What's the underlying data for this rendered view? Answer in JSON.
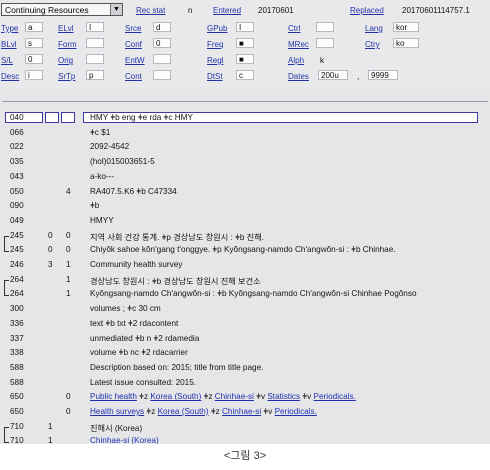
{
  "fixed_fields": {
    "material_type": "Continuing Resources",
    "rec_stat": {
      "label": "Rec stat",
      "value": "n"
    },
    "entered": {
      "label": "Entered",
      "value": "20170601"
    },
    "replaced": {
      "label": "Replaced",
      "value": "20170601114757.1"
    },
    "type": {
      "label": "Type",
      "value": "a"
    },
    "elvl": {
      "label": "ELvl",
      "value": "I"
    },
    "srce": {
      "label": "Srce",
      "value": "d"
    },
    "gpub": {
      "label": "GPub",
      "value": "I"
    },
    "ctrl": {
      "label": "Ctrl",
      "value": ""
    },
    "lang": {
      "label": "Lang",
      "value": "kor"
    },
    "blvl": {
      "label": "BLvl",
      "value": "s"
    },
    "form": {
      "label": "Form",
      "value": ""
    },
    "conf": {
      "label": "Conf",
      "value": "0"
    },
    "freq": {
      "label": "Freq",
      "value": "■"
    },
    "mrec": {
      "label": "MRec",
      "value": ""
    },
    "ctry": {
      "label": "Ctry",
      "value": "ko"
    },
    "sl": {
      "label": "S/L",
      "value": "0"
    },
    "orig": {
      "label": "Orig",
      "value": ""
    },
    "entw": {
      "label": "EntW",
      "value": ""
    },
    "regl": {
      "label": "Regl",
      "value": "■"
    },
    "alph": {
      "label": "Alph",
      "value": "k"
    },
    "desc": {
      "label": "Desc",
      "value": "i"
    },
    "srtp": {
      "label": "SrTp",
      "value": "p"
    },
    "cont": {
      "label": "Cont",
      "value": ""
    },
    "dtst": {
      "label": "DtSt",
      "value": "c"
    },
    "dates": {
      "label": "Dates",
      "value1": "200u",
      "separator": ",",
      "value2": "9999"
    }
  },
  "fields": [
    {
      "tag": "040",
      "i1": "",
      "i2": "",
      "content": "HMY ǂb eng ǂe rda ǂc HMY",
      "focused": true
    },
    {
      "tag": "066",
      "i1": "",
      "i2": "",
      "content": "ǂc $1"
    },
    {
      "tag": "022",
      "i1": "",
      "i2": "",
      "content": "2092-4542"
    },
    {
      "tag": "035",
      "i1": "",
      "i2": "",
      "content": "(hol)015003651-5"
    },
    {
      "tag": "043",
      "i1": "",
      "i2": "",
      "content": "a-ko---"
    },
    {
      "tag": "050",
      "i1": "",
      "i2": "4",
      "content": "RA407.5.K6 ǂb C47334"
    },
    {
      "tag": "090",
      "i1": "",
      "i2": "",
      "content": "ǂb"
    },
    {
      "tag": "049",
      "i1": "",
      "i2": "",
      "content": "HMYY"
    },
    {
      "tag": "245",
      "i1": "0",
      "i2": "0",
      "content": "지역 사회 건강 통계. ǂp 경상남도 창원시 : ǂb 진해.",
      "linked_start": true
    },
    {
      "tag": "245",
      "i1": "0",
      "i2": "0",
      "content": "Chiyŏk sahoe kŏn'gang t'onggye. ǂp Kyŏngsang-namdo Ch'angwŏn-si : ǂb Chinhae.",
      "linked_end": true
    },
    {
      "tag": "246",
      "i1": "3",
      "i2": "1",
      "content": "Community health survey"
    },
    {
      "tag": "264",
      "i1": "",
      "i2": "1",
      "content": "경상남도 창원시 : ǂb 경상남도 창원시 진해 보건소",
      "linked_start": true
    },
    {
      "tag": "264",
      "i1": "",
      "i2": "1",
      "content": "Kyŏngsang-namdo Ch'angwŏn-si : ǂb Kyŏngsang-namdo Ch'angwŏn-si Chinhae Pogŏnso",
      "linked_end": true
    },
    {
      "tag": "300",
      "i1": "",
      "i2": "",
      "content": "volumes ; ǂc 30 cm"
    },
    {
      "tag": "336",
      "i1": "",
      "i2": "",
      "content": "text ǂb txt ǂ2 rdacontent"
    },
    {
      "tag": "337",
      "i1": "",
      "i2": "",
      "content": "unmediated ǂb n ǂ2 rdamedia"
    },
    {
      "tag": "338",
      "i1": "",
      "i2": "",
      "content": "volume ǂb nc ǂ2 rdacarrier"
    },
    {
      "tag": "588",
      "i1": "",
      "i2": "",
      "content": "Description based on: 2015; title from title page."
    },
    {
      "tag": "588",
      "i1": "",
      "i2": "",
      "content": "Latest issue consulted: 2015."
    },
    {
      "tag": "650",
      "i1": "",
      "i2": "0",
      "parts": [
        "Public health",
        " ǂz ",
        "Korea (South)",
        " ǂz ",
        "Chinhae-si",
        " ǂv ",
        "Statistics",
        " ǂv ",
        "Periodicals."
      ]
    },
    {
      "tag": "650",
      "i1": "",
      "i2": "0",
      "parts": [
        "Health surveys",
        " ǂz ",
        "Korea (South)",
        " ǂz ",
        "Chinhae-si",
        " ǂv ",
        "Periodicals."
      ]
    },
    {
      "tag": "710",
      "i1": "1",
      "i2": "",
      "content": "진해시 (Korea)",
      "linked_start": true
    },
    {
      "tag": "710",
      "i1": "1",
      "i2": "",
      "content": "Chinhae-si (Korea)",
      "link": true,
      "linked_end": true
    }
  ],
  "caption": "<그림 3>"
}
